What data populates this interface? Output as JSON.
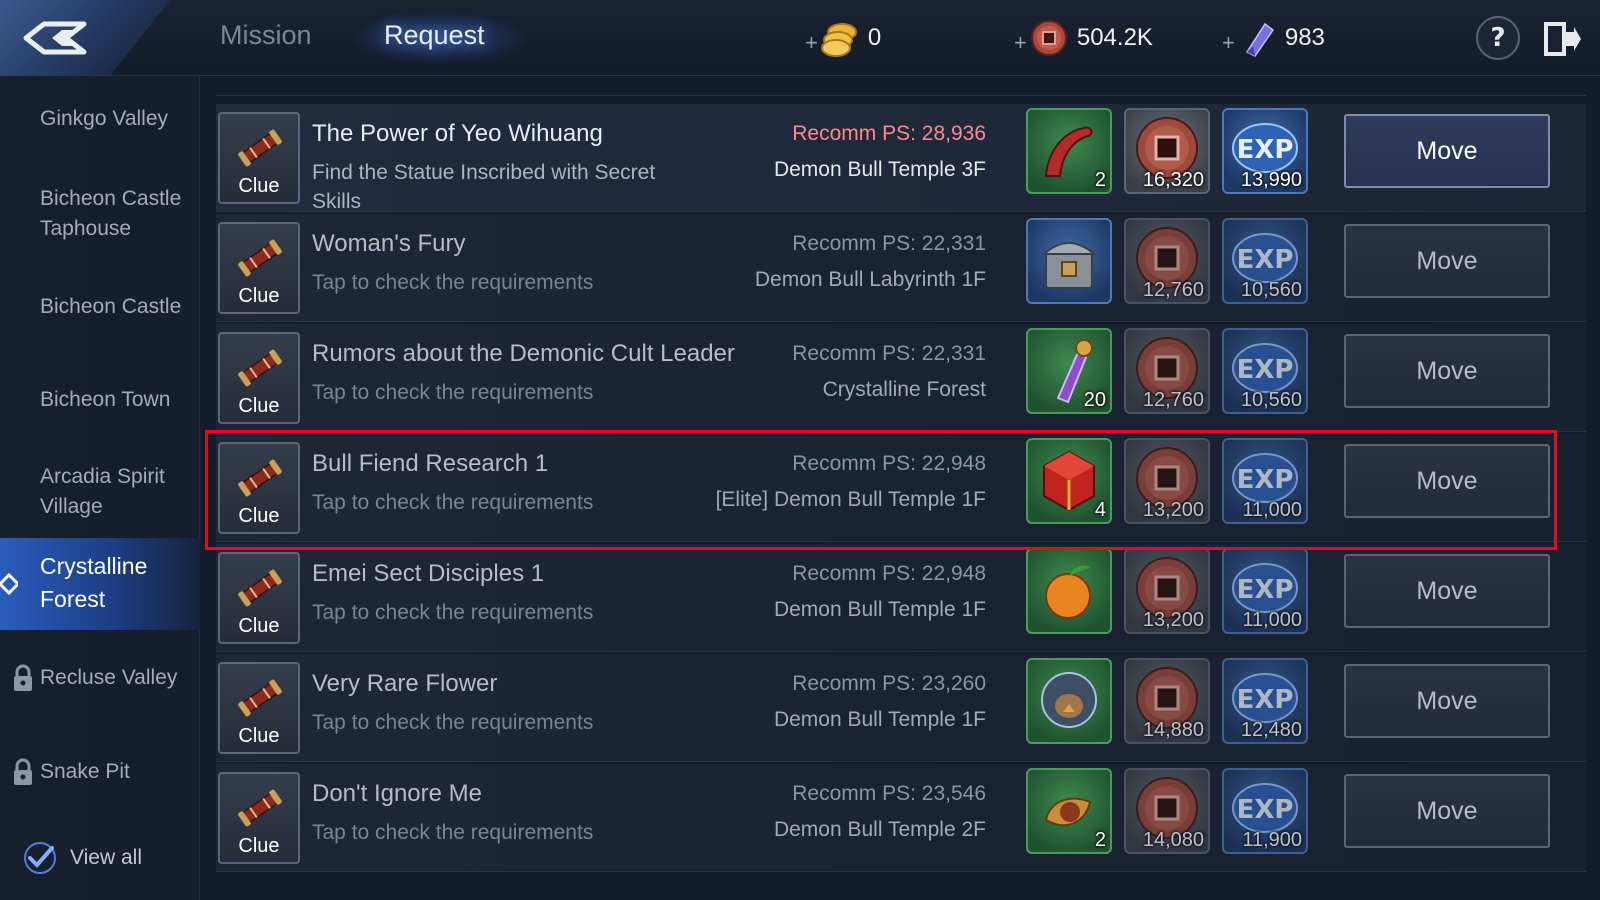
{
  "header": {
    "tabs": [
      {
        "label": "Mission",
        "active": false
      },
      {
        "label": "Request",
        "active": true
      }
    ],
    "currencies": [
      {
        "name": "gold-coin-icon",
        "plus": "+",
        "value": "0"
      },
      {
        "name": "copper-coin-icon",
        "plus": "+",
        "value": "504.2K"
      },
      {
        "name": "purple-crystal-icon",
        "plus": "+",
        "value": "983"
      }
    ],
    "help_label": "?"
  },
  "sidebar": {
    "items": [
      {
        "label": "Ginkgo Valley",
        "locked": false,
        "active": false
      },
      {
        "label": "Bicheon Castle Taphouse",
        "locked": false,
        "active": false
      },
      {
        "label": "Bicheon Castle",
        "locked": false,
        "active": false
      },
      {
        "label": "Bicheon Town",
        "locked": false,
        "active": false
      },
      {
        "label": "Arcadia Spirit Village",
        "locked": false,
        "active": false
      },
      {
        "label": "Crystalline Forest",
        "locked": false,
        "active": true
      },
      {
        "label": "Recluse Valley",
        "locked": true,
        "active": false
      },
      {
        "label": "Snake Pit",
        "locked": true,
        "active": false
      }
    ],
    "view_all": {
      "label": "View all",
      "checked": true
    }
  },
  "quests": [
    {
      "clue_label": "Clue",
      "title": "The Power of Yeo Wihuang",
      "description": "Find the Statue Inscribed with Secret Skills",
      "recommended_ps": "Recomm PS: 28,936",
      "location": "Demon Bull Temple 3F",
      "rewards": [
        {
          "icon": "red-tentacle-item-icon",
          "qty": "2"
        },
        {
          "icon": "copper-coin-icon",
          "qty": "16,320"
        },
        {
          "icon": "exp-orb-icon",
          "qty": "13,990"
        }
      ],
      "move_label": "Move"
    },
    {
      "clue_label": "Clue",
      "title": "Woman's Fury",
      "description": "Tap to check the requirements",
      "recommended_ps": "Recomm PS: 22,331",
      "location": "Demon Bull Labyrinth 1F",
      "rewards": [
        {
          "icon": "treasure-chest-icon",
          "qty": ""
        },
        {
          "icon": "copper-coin-icon",
          "qty": "12,760"
        },
        {
          "icon": "exp-orb-icon",
          "qty": "10,560"
        }
      ],
      "move_label": "Move"
    },
    {
      "clue_label": "Clue",
      "title": "Rumors about the Demonic Cult Leader",
      "description": "Tap to check the requirements",
      "recommended_ps": "Recomm PS: 22,331",
      "location": "Crystalline Forest",
      "rewards": [
        {
          "icon": "purple-gem-item-icon",
          "qty": "20"
        },
        {
          "icon": "copper-coin-icon",
          "qty": "12,760"
        },
        {
          "icon": "exp-orb-icon",
          "qty": "10,560"
        }
      ],
      "move_label": "Move"
    },
    {
      "clue_label": "Clue",
      "title": "Bull Fiend Research 1",
      "description": "Tap to check the requirements",
      "recommended_ps": "Recomm PS: 22,948",
      "location": "[Elite] Demon Bull Temple 1F",
      "rewards": [
        {
          "icon": "red-cube-item-icon",
          "qty": "4"
        },
        {
          "icon": "copper-coin-icon",
          "qty": "13,200"
        },
        {
          "icon": "exp-orb-icon",
          "qty": "11,000"
        }
      ],
      "move_label": "Move"
    },
    {
      "clue_label": "Clue",
      "title": "Emei Sect Disciples 1",
      "description": "Tap to check the requirements",
      "recommended_ps": "Recomm PS: 22,948",
      "location": "Demon Bull Temple 1F",
      "rewards": [
        {
          "icon": "orange-fruit-item-icon",
          "qty": ""
        },
        {
          "icon": "copper-coin-icon",
          "qty": "13,200"
        },
        {
          "icon": "exp-orb-icon",
          "qty": "11,000"
        }
      ],
      "move_label": "Move"
    },
    {
      "clue_label": "Clue",
      "title": "Very Rare Flower",
      "description": "Tap to check the requirements",
      "recommended_ps": "Recomm PS: 23,260",
      "location": "Demon Bull Temple 1F",
      "rewards": [
        {
          "icon": "bird-orb-item-icon",
          "qty": ""
        },
        {
          "icon": "copper-coin-icon",
          "qty": "14,880"
        },
        {
          "icon": "exp-orb-icon",
          "qty": "12,480"
        }
      ],
      "move_label": "Move"
    },
    {
      "clue_label": "Clue",
      "title": "Don't Ignore Me",
      "description": "Tap to check the requirements",
      "recommended_ps": "Recomm PS: 23,546",
      "location": "Demon Bull Temple 2F",
      "rewards": [
        {
          "icon": "golden-seed-item-icon",
          "qty": "2"
        },
        {
          "icon": "copper-coin-icon",
          "qty": "14,080"
        },
        {
          "icon": "exp-orb-icon",
          "qty": "11,900"
        }
      ],
      "move_label": "Move"
    }
  ],
  "colors": {
    "highlight": "#e0101a",
    "recommended_ps_warning": "#ff8a8a",
    "active_sidebar": "#2b5dbd"
  }
}
